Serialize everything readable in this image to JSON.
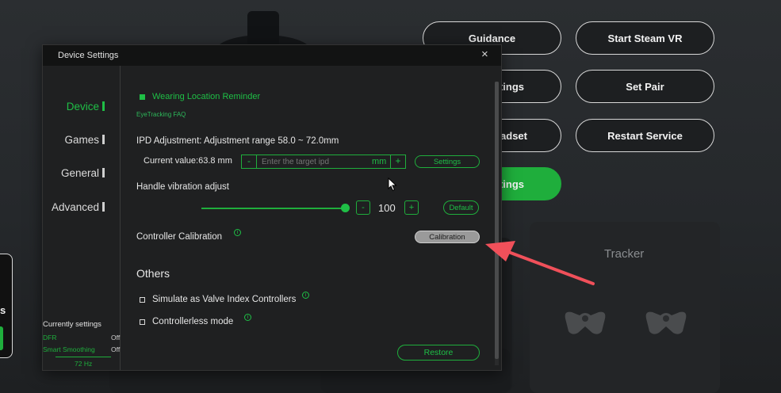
{
  "background": {
    "buttons": [
      {
        "label": "Guidance"
      },
      {
        "label": "Start Steam VR"
      },
      {
        "label": "ttings"
      },
      {
        "label": "Set Pair"
      },
      {
        "label": "eadset"
      },
      {
        "label": "Restart Service"
      },
      {
        "label": "ttings"
      }
    ],
    "tracker_label": "Tracker",
    "left_card_text": "s"
  },
  "dialog": {
    "title": "Device Settings",
    "close_icon": "×",
    "sidebar": {
      "items": [
        {
          "label": "Device",
          "active": true
        },
        {
          "label": "Games",
          "active": false
        },
        {
          "label": "General",
          "active": false
        },
        {
          "label": "Advanced",
          "active": false
        }
      ],
      "current_settings": {
        "title": "Currently settings",
        "rows": [
          {
            "name": "DFR",
            "value": "Off"
          },
          {
            "name": "Smart Smoothing",
            "value": "Off"
          }
        ],
        "refresh": "72 Hz"
      }
    },
    "wearing_reminder": {
      "label": "Wearing Location Reminder",
      "checked": true
    },
    "eyetracking_faq": "EyeTracking FAQ",
    "ipd": {
      "heading": "IPD Adjustment: Adjustment range 58.0 ~ 72.0mm",
      "current_value": "Current value:63.8 mm",
      "minus": "-",
      "plus": "+",
      "placeholder": "Enter the target ipd",
      "unit": "mm",
      "settings_button": "Settings"
    },
    "vibration": {
      "label": "Handle vibration adjust",
      "value": "100",
      "minus": "-",
      "plus": "+",
      "default_button": "Default",
      "level_fraction": 1.0
    },
    "calibration": {
      "label": "Controller Calibration",
      "button": "Calibration",
      "info_icon": "i"
    },
    "others": {
      "heading": "Others",
      "options": [
        {
          "label": "Simulate as Valve Index Controllers",
          "checked": false
        },
        {
          "label": "Controllerless mode",
          "checked": false
        }
      ]
    },
    "restore_button": "Restore"
  },
  "colors": {
    "accent_green": "#1fbf46",
    "annotation_arrow": "#f0505a"
  }
}
